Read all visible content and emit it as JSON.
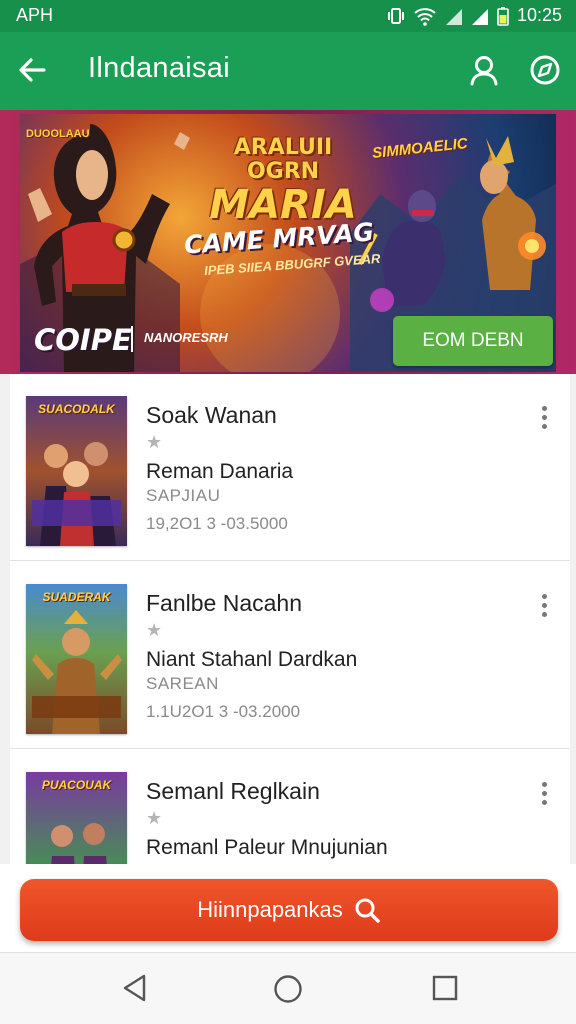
{
  "status": {
    "carrier": "APH",
    "time": "10:25",
    "icons": [
      "vibrate-icon",
      "wifi-icon",
      "signal-icon",
      "signal-4g-icon",
      "battery-icon"
    ]
  },
  "appbar": {
    "title": "Ilndanaisai",
    "icons": [
      "back-arrow-icon",
      "profile-icon",
      "compass-icon"
    ]
  },
  "banner": {
    "badge": "DUOOLAAU",
    "title_line1": "ARALUII OGRN",
    "title_line2": "MARIA",
    "subtitle": "CAME MRVAG",
    "small_text": "IPEB SIIEA BBUGRF GVEAR",
    "tag": "SIMMOAELIC",
    "brand": "COIPE",
    "publisher": "NANORESRH",
    "cta_label": "EOM DEBN"
  },
  "games": [
    {
      "cover_title": "SUACODALK",
      "title": "Soak Wanan",
      "subtitle": "Reman Danaria",
      "tag": "SAPJIAU",
      "meta": "19,2O1 3  -03.5000"
    },
    {
      "cover_title": "SUADERAK",
      "title": "Fanlbe Nacahn",
      "subtitle": "Niant Stahanl Dardkan",
      "tag": "SAREAN",
      "meta": "1.1U2O1 3  -03.2000"
    },
    {
      "cover_title": "PUACOUAK",
      "title": "Semanl Reglkain",
      "subtitle": "Remanl Paleur Mnujunian",
      "tag": "",
      "meta": ""
    }
  ],
  "search_button": {
    "label": "Hiinnpapankas",
    "icon": "search-icon"
  },
  "nav": {
    "icons": [
      "nav-back-icon",
      "nav-home-icon",
      "nav-recents-icon"
    ]
  },
  "colors": {
    "appbar": "#1b9e55",
    "statusbar": "#16904a",
    "cta": "#5bb043",
    "search": "#e84623"
  }
}
